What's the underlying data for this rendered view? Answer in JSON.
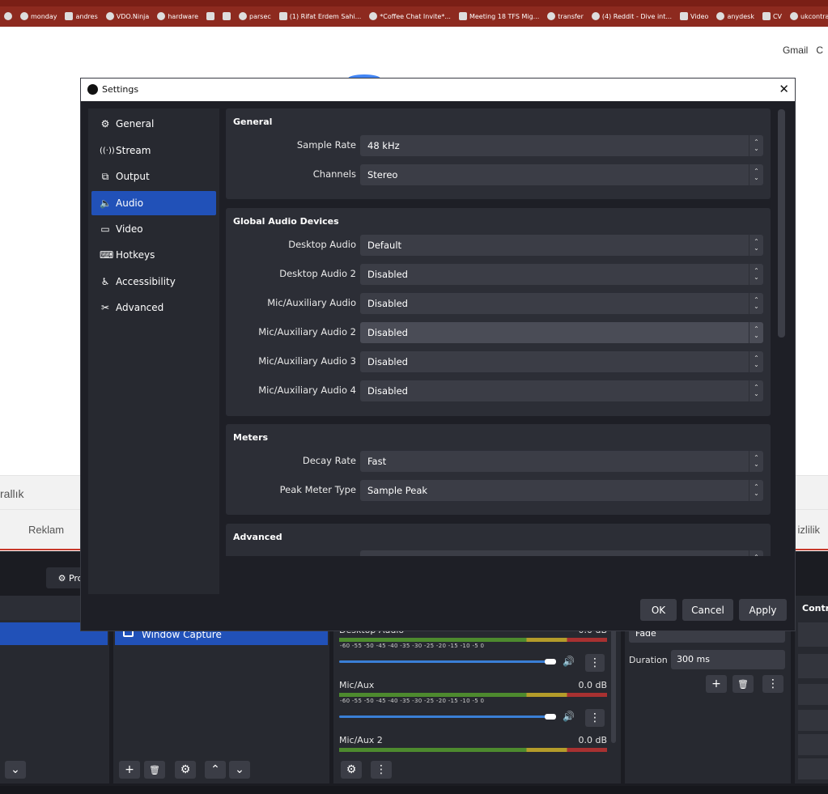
{
  "browser": {
    "bookmarks": [
      "monday",
      "andres",
      "VDO.Ninja",
      "hardware",
      "parsec",
      "(1) Rifat Erdem Sahi...",
      "*Coffee Chat Invite*...",
      "Meeting 18 TFS Mig...",
      "transfer",
      "(4) Reddit - Dive int...",
      "Video",
      "anydesk",
      "CV",
      "ukcontractpe"
    ]
  },
  "google": {
    "gmail_link": "Gmail",
    "gmail_suffix": "C",
    "location_fragment": "rallık",
    "footer_left": "Reklam",
    "footer_right": "izlilik"
  },
  "obs_main": {
    "profile_button": "Pro",
    "controls_header": "Contr",
    "source_item": "Window Capture",
    "mixer": {
      "top_label": "Desktop Audio",
      "top_db": "0.0 dB",
      "channels": [
        {
          "name": "Mic/Aux",
          "db": "0.0 dB"
        },
        {
          "name": "Mic/Aux 2",
          "db": "0.0 dB"
        }
      ],
      "scale": "-60  -55  -50  -45  -40  -35  -30  -25  -20  -15  -10   -5    0"
    },
    "transition": {
      "type": "Fade",
      "duration_label": "Duration",
      "duration_value": "300 ms"
    }
  },
  "settings": {
    "title": "Settings",
    "nav": [
      {
        "label": "General",
        "icon": "gear-icon"
      },
      {
        "label": "Stream",
        "icon": "broadcast-icon"
      },
      {
        "label": "Output",
        "icon": "output-icon"
      },
      {
        "label": "Audio",
        "icon": "speaker-icon",
        "active": true
      },
      {
        "label": "Video",
        "icon": "monitor-icon"
      },
      {
        "label": "Hotkeys",
        "icon": "keyboard-icon"
      },
      {
        "label": "Accessibility",
        "icon": "accessibility-icon"
      },
      {
        "label": "Advanced",
        "icon": "tools-icon"
      }
    ],
    "groups": {
      "general": {
        "title": "General",
        "rows": [
          {
            "label": "Sample Rate",
            "value": "48 kHz"
          },
          {
            "label": "Channels",
            "value": "Stereo"
          }
        ]
      },
      "devices": {
        "title": "Global Audio Devices",
        "rows": [
          {
            "label": "Desktop Audio",
            "value": "Default"
          },
          {
            "label": "Desktop Audio 2",
            "value": "Disabled"
          },
          {
            "label": "Mic/Auxiliary Audio",
            "value": "Disabled"
          },
          {
            "label": "Mic/Auxiliary Audio 2",
            "value": "Disabled"
          },
          {
            "label": "Mic/Auxiliary Audio 3",
            "value": "Disabled"
          },
          {
            "label": "Mic/Auxiliary Audio 4",
            "value": "Disabled"
          }
        ]
      },
      "meters": {
        "title": "Meters",
        "rows": [
          {
            "label": "Decay Rate",
            "value": "Fast"
          },
          {
            "label": "Peak Meter Type",
            "value": "Sample Peak"
          }
        ]
      },
      "advanced": {
        "title": "Advanced"
      }
    },
    "buttons": {
      "ok": "OK",
      "cancel": "Cancel",
      "apply": "Apply"
    }
  }
}
